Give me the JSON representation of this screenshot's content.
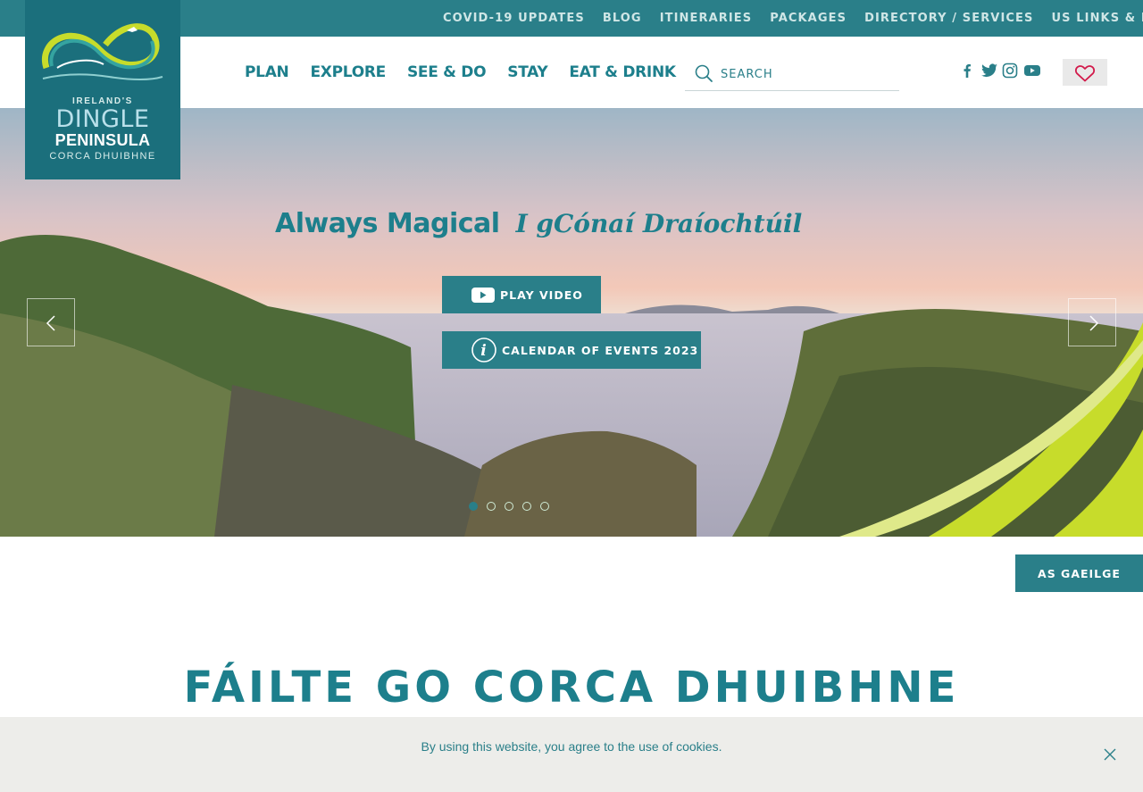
{
  "topbar": {
    "links": [
      "COVID-19 UPDATES",
      "BLOG",
      "ITINERARIES",
      "PACKAGES",
      "DIRECTORY / SERVICES",
      "US LINKS & BIG E"
    ]
  },
  "logo": {
    "line1": "IRELAND'S",
    "line2": "DINGLE",
    "line3": "PENINSULA",
    "line4": "CORCA DHUIBHNE"
  },
  "nav": {
    "items": [
      "PLAN",
      "EXPLORE",
      "SEE & DO",
      "STAY",
      "EAT & DRINK"
    ]
  },
  "search": {
    "placeholder": "SEARCH"
  },
  "social": {
    "icons": [
      "facebook-icon",
      "twitter-icon",
      "instagram-icon",
      "youtube-icon"
    ]
  },
  "favourites": {
    "icon": "heart-icon"
  },
  "hero": {
    "tagline_en": "Always Magical",
    "tagline_ga": "I gCónaí Draíochtúil",
    "play_video": "PLAY VIDEO",
    "calendar": "CALENDAR OF EVENTS 2023",
    "slide_count": 5,
    "active_slide": 1
  },
  "language": {
    "label": "AS GAEILGE"
  },
  "welcome": {
    "title": "FÁILTE GO CORCA DHUIBHNE"
  },
  "cookie": {
    "text": "By using this website, you agree to the use of cookies."
  },
  "colors": {
    "teal": "#2a7f89",
    "accent_green": "#c7dc2b"
  }
}
